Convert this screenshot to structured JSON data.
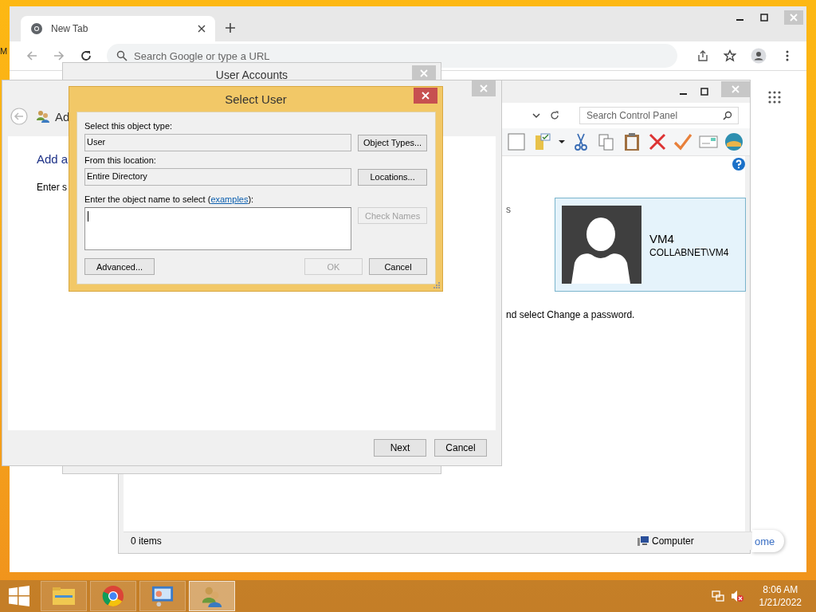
{
  "desktop": {
    "icon_label": "M"
  },
  "browser": {
    "tabs": [
      {
        "label": "New Tab",
        "selected": true
      }
    ],
    "omnibox": {
      "placeholder": "Search Google or type a URL"
    },
    "customize_button": {
      "label": "ome"
    }
  },
  "control_panel": {
    "search": {
      "placeholder": "Search Control Panel"
    },
    "text_fragment": "s",
    "account": {
      "name": "VM4",
      "domain": "COLLABNET\\VM4",
      "selected": true
    },
    "instruction": "nd select Change a password.",
    "status_bar": {
      "items": "0 items",
      "location": "Computer"
    }
  },
  "user_accounts": {
    "title": "User Accounts"
  },
  "wizard": {
    "heading": "Ad",
    "title": "Add a",
    "prompt": "Enter s",
    "buttons": [
      {
        "label": "Next"
      },
      {
        "label": "Cancel"
      }
    ]
  },
  "select_user": {
    "title": "Select User",
    "object_type": {
      "label": "Select this object type:",
      "value": "User",
      "button": {
        "label": "Object Types...",
        "disabled": false
      }
    },
    "location": {
      "label": "From this location:",
      "value": "Entire Directory",
      "button": {
        "label": "Locations...",
        "disabled": false
      }
    },
    "names": {
      "label": "Enter the object name to select (",
      "link": "examples",
      "label_end": "):",
      "button": {
        "label": "Check Names",
        "disabled": true
      }
    },
    "buttons": [
      {
        "label": "Advanced...",
        "disabled": false
      },
      {
        "label": "OK",
        "disabled": true
      },
      {
        "label": "Cancel",
        "disabled": false
      }
    ]
  },
  "taskbar": {
    "apps": [
      {
        "kind": "explorer",
        "active": false
      },
      {
        "kind": "browser",
        "active": false
      },
      {
        "kind": "control",
        "active": false
      },
      {
        "kind": "users",
        "active": true
      }
    ],
    "time": "8:06 AM",
    "date": "1/21/2022"
  }
}
